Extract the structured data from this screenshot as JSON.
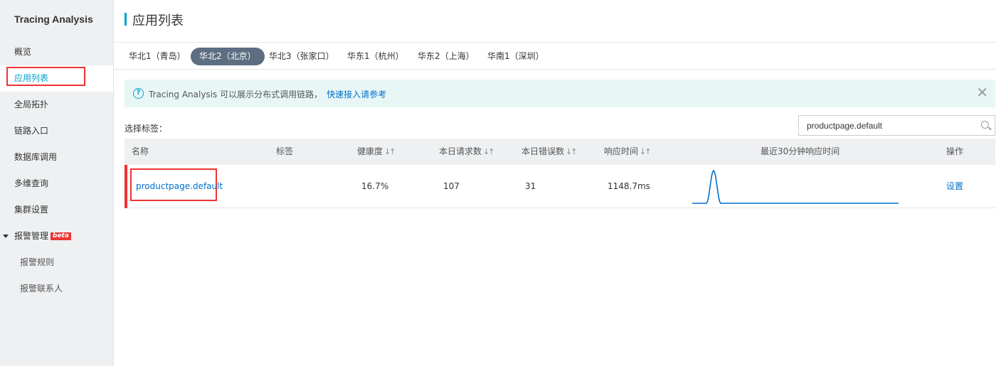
{
  "app": {
    "brand": "Tracing Analysis",
    "page_title": "应用列表"
  },
  "sidebar": {
    "items": [
      {
        "label": "概览"
      },
      {
        "label": "应用列表"
      },
      {
        "label": "全局拓扑"
      },
      {
        "label": "链路入口"
      },
      {
        "label": "数据库调用"
      },
      {
        "label": "多维查询"
      },
      {
        "label": "集群设置"
      },
      {
        "label": "报警管理",
        "badge": "beta"
      },
      {
        "label": "报警规则"
      },
      {
        "label": "报警联系人"
      }
    ]
  },
  "regions": [
    {
      "label": "华北1（青岛）"
    },
    {
      "label": "华北2（北京）",
      "selected": true
    },
    {
      "label": "华北3（张家口）"
    },
    {
      "label": "华东1（杭州）"
    },
    {
      "label": "华东2（上海）"
    },
    {
      "label": "华南1（深圳）"
    }
  ],
  "notice": {
    "text": "Tracing Analysis 可以展示分布式调用链路，",
    "link": "快速接入请参考",
    "close": "✕",
    "help": "?"
  },
  "filter": {
    "label": "选择标签："
  },
  "search": {
    "value": "productpage.default",
    "icon": "search-icon"
  },
  "table": {
    "columns": {
      "name": "名称",
      "tags": "标签",
      "health": "健康度",
      "requests": "本日请求数",
      "errors": "本日错误数",
      "response": "响应时间",
      "recent": "最近30分钟响应时间",
      "action": "操作"
    },
    "sort_glyph": "↓↑",
    "rows": [
      {
        "name": "productpage.default",
        "tags": "",
        "health": "16.7%",
        "requests": "107",
        "errors": "31",
        "response": "1148.7ms",
        "action": "设置",
        "sparkline": [
          0,
          0,
          0,
          1148.7,
          0,
          0,
          0,
          0,
          0,
          0,
          0,
          0,
          0,
          0,
          0,
          0,
          0,
          0,
          0,
          0,
          0,
          0,
          0,
          0,
          0,
          0,
          0,
          0,
          0,
          0
        ]
      }
    ]
  },
  "colors": {
    "accent": "#00a2ca",
    "link": "#0070cc",
    "tab_active": "#5d6d82",
    "highlight": "#ee3333"
  }
}
